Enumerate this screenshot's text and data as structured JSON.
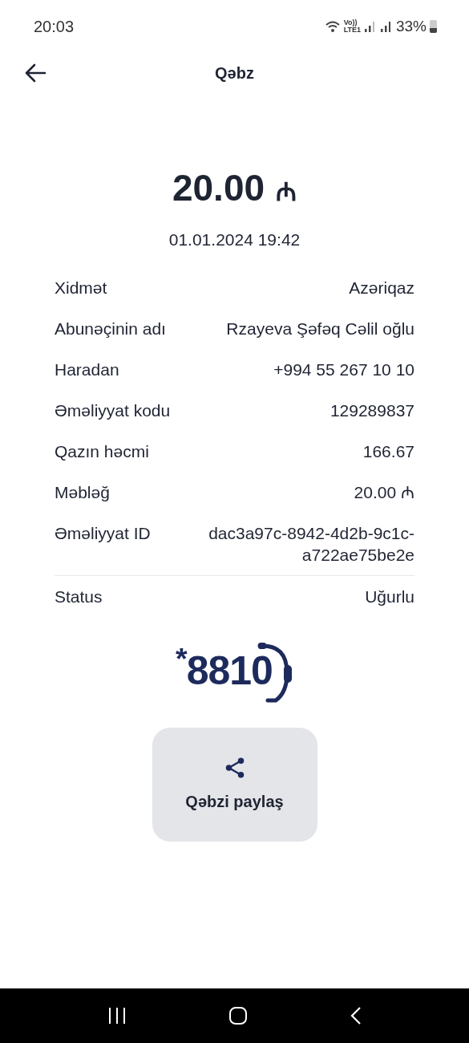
{
  "status_bar": {
    "time": "20:03",
    "volte_top": "Vo))",
    "volte_bottom": "LTE1",
    "battery_text": "33%"
  },
  "header": {
    "title": "Qəbz"
  },
  "amount": {
    "value": "20.00",
    "currency": "₼"
  },
  "datetime": "01.01.2024 19:42",
  "details": [
    {
      "label": "Xidmət",
      "value": "Azəriqaz"
    },
    {
      "label": "Abunəçinin adı",
      "value": "Rzayeva Şəfəq Cəlil oğlu"
    },
    {
      "label": "Haradan",
      "value": "+994 55 267 10 10"
    },
    {
      "label": "Əməliyyat kodu",
      "value": "129289837"
    },
    {
      "label": "Qazın həcmi",
      "value": "166.67"
    },
    {
      "label": "Məbləğ",
      "value": "20.00 ₼"
    },
    {
      "label": "Əməliyyat ID",
      "value": "dac3a97c-8942-4d2b-9c1c-a722ae75be2e"
    }
  ],
  "status_row": {
    "label": "Status",
    "value": "Uğurlu"
  },
  "logo": {
    "text": "$^{*}$8810"
  },
  "share_button": {
    "label": "Qəbzi paylaş"
  }
}
